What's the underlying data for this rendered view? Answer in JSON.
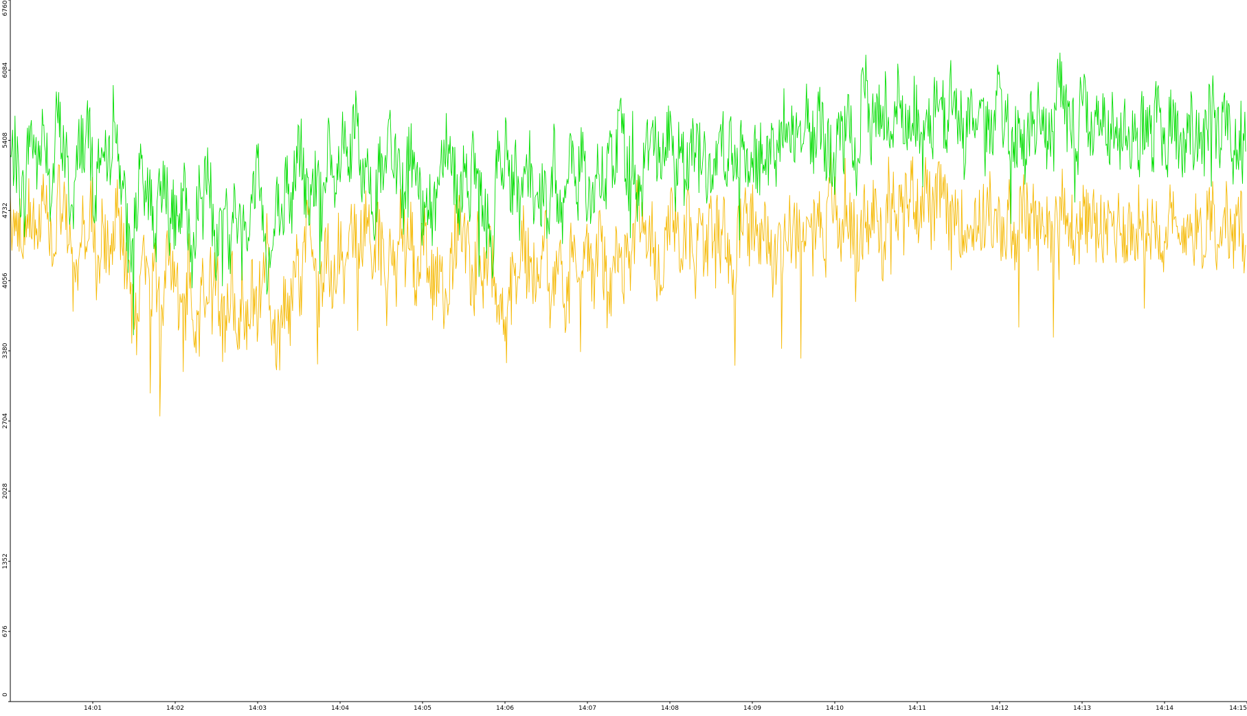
{
  "chart_data": {
    "type": "line",
    "title": "",
    "xlabel": "",
    "ylabel": "",
    "ylim": [
      0,
      6760
    ],
    "y_ticks": [
      "0",
      "676",
      "1352",
      "2028",
      "2704",
      "3380",
      "4056",
      "4732",
      "5408",
      "6084",
      "6760"
    ],
    "x_ticks": [
      "14:01",
      "14:02",
      "14:03",
      "14:04",
      "14:05",
      "14:06",
      "14:07",
      "14:08",
      "14:09",
      "14:10",
      "14:11",
      "14:12",
      "14:13",
      "14:14",
      "14:15"
    ],
    "x_start": "14:00:00",
    "x_end": "14:15:00",
    "grid": false,
    "legend": "none",
    "series": [
      {
        "color": "#00dd00",
        "values": [
          5200,
          5300,
          5000,
          4800,
          5500,
          5400,
          5100,
          5600,
          5300,
          4900,
          5700,
          5400,
          5200,
          4700,
          5000,
          5500,
          5300,
          5600,
          4600,
          5400,
          5200,
          5100,
          5700,
          5300,
          5000,
          4500,
          4300,
          4800,
          5100,
          4700,
          5000,
          4400,
          4900,
          5200,
          4600,
          4700,
          4400,
          5000,
          4500,
          4300,
          4900,
          4700,
          5100,
          4800,
          4300,
          4700,
          4900,
          4200,
          4800,
          4500,
          4800,
          4500,
          4900,
          5300,
          4600,
          4200,
          4300,
          4800,
          4500,
          5100,
          4700,
          5200,
          5400,
          4900,
          4700,
          5000,
          5100,
          4700,
          5300,
          4900,
          5000,
          5400,
          5100,
          5300,
          5700,
          4800,
          5300,
          5100,
          4700,
          5200,
          4900,
          5600,
          5000,
          5400,
          4800,
          5200,
          5300,
          4900,
          4700,
          5000,
          4600,
          4900,
          5200,
          5500,
          5300,
          5100,
          4700,
          5300,
          4900,
          5200,
          5000,
          4700,
          4600,
          4300,
          5300,
          4900,
          5400,
          5000,
          5100,
          4700,
          4900,
          5300,
          4600,
          4800,
          5000,
          4400,
          5300,
          4900,
          4700,
          5000,
          5200,
          4700,
          5400,
          5000,
          4600,
          4900,
          5200,
          4800,
          5300,
          5100,
          5600,
          5500,
          5000,
          5400,
          4900,
          5000,
          5300,
          5600,
          5400,
          5100,
          5300,
          5600,
          5000,
          5400,
          5100,
          5300,
          5500,
          5200,
          5400,
          5000,
          4900,
          5300,
          5600,
          5200,
          5500,
          5000,
          5400,
          5200,
          4900,
          5300,
          5100,
          5500,
          5200,
          5400,
          5100,
          5600,
          5700,
          5400,
          5500,
          5200,
          5800,
          5500,
          5200,
          5700,
          5400,
          5300,
          5100,
          5500,
          5300,
          5600,
          5400,
          5100,
          5800,
          5900,
          5500,
          5700,
          5600,
          5800,
          5500,
          5700,
          5900,
          5400,
          5600,
          5800,
          5500,
          5300,
          5600,
          5400,
          6000,
          5800,
          5500,
          5900,
          5600,
          5700,
          5300,
          5600,
          5800,
          5400,
          5700,
          5500,
          5400,
          5800,
          5600,
          5700,
          5400,
          5500,
          5400,
          5300,
          5600,
          5500,
          5700,
          5400,
          5500,
          5300,
          6300,
          5800,
          5500,
          5600,
          5500,
          5900,
          5700,
          5400,
          5800,
          5700,
          5600,
          5500,
          5600,
          5400,
          5700,
          5500,
          5400,
          5300,
          5600,
          5500,
          5400,
          5700,
          5500,
          5300,
          5600,
          5500,
          5300,
          5400,
          5600,
          5400,
          5500,
          5300,
          5600,
          5700,
          5400,
          5500,
          5600,
          5300,
          5400,
          5500,
          5300
        ]
      },
      {
        "color": "#f5b800",
        "values": [
          4600,
          4700,
          4500,
          4400,
          4800,
          4700,
          4500,
          4900,
          4600,
          4300,
          4900,
          4700,
          4500,
          4100,
          4300,
          4700,
          4500,
          4800,
          3900,
          4600,
          4400,
          4300,
          4900,
          4500,
          4200,
          3800,
          3600,
          4100,
          4300,
          3900,
          4200,
          3700,
          4100,
          4400,
          3900,
          3900,
          3600,
          4200,
          3700,
          3500,
          4100,
          3900,
          4300,
          4000,
          3500,
          3900,
          4100,
          3400,
          4000,
          3700,
          4000,
          3700,
          4100,
          4500,
          3800,
          3400,
          3500,
          4000,
          3700,
          4300,
          3900,
          4400,
          4600,
          4100,
          3900,
          4200,
          4300,
          3900,
          4500,
          4100,
          4200,
          4600,
          4300,
          4500,
          4900,
          4000,
          4500,
          4300,
          3900,
          4400,
          4100,
          4800,
          4200,
          4600,
          4000,
          4400,
          4500,
          4100,
          3900,
          4200,
          3800,
          4100,
          4400,
          4700,
          4500,
          4300,
          3900,
          4500,
          4100,
          4400,
          4200,
          3900,
          3800,
          3500,
          4500,
          4100,
          4600,
          4200,
          4300,
          3900,
          4100,
          4500,
          3800,
          4000,
          4200,
          3600,
          4500,
          4100,
          3900,
          4200,
          4400,
          3900,
          4600,
          4200,
          3800,
          4100,
          4400,
          4000,
          4500,
          4300,
          4800,
          4700,
          4200,
          4600,
          4100,
          4200,
          4500,
          4800,
          4600,
          4300,
          4500,
          4800,
          4200,
          4600,
          4300,
          4500,
          4700,
          4400,
          4600,
          4200,
          4100,
          4500,
          4800,
          4400,
          4700,
          4200,
          4600,
          4400,
          4100,
          4500,
          4300,
          4700,
          4400,
          4600,
          4300,
          4800,
          4900,
          4600,
          4700,
          4400,
          5000,
          4700,
          4400,
          4900,
          4600,
          4500,
          4300,
          4700,
          4500,
          4800,
          4600,
          4300,
          5000,
          5000,
          4700,
          4900,
          4800,
          5000,
          4700,
          4900,
          5000,
          4600,
          4800,
          5000,
          4700,
          4500,
          4800,
          4600,
          4600,
          4500,
          4700,
          4600,
          4700,
          4800,
          4500,
          4600,
          4400,
          4700,
          4500,
          4600,
          4800,
          4600,
          4700,
          4500,
          4600,
          4700,
          4500,
          4700,
          4800,
          4500,
          4600,
          4400,
          4700,
          4600,
          4800,
          4500,
          4600,
          4400,
          4700,
          4500,
          4700,
          4500,
          4600,
          4400,
          4700,
          4600,
          4500,
          4700,
          4600,
          4400,
          4700,
          4600,
          4400,
          4500,
          4700,
          4500,
          4600,
          4400,
          4700,
          4800,
          4500,
          4600,
          4700,
          4400,
          4500,
          4600,
          4400
        ]
      }
    ]
  }
}
